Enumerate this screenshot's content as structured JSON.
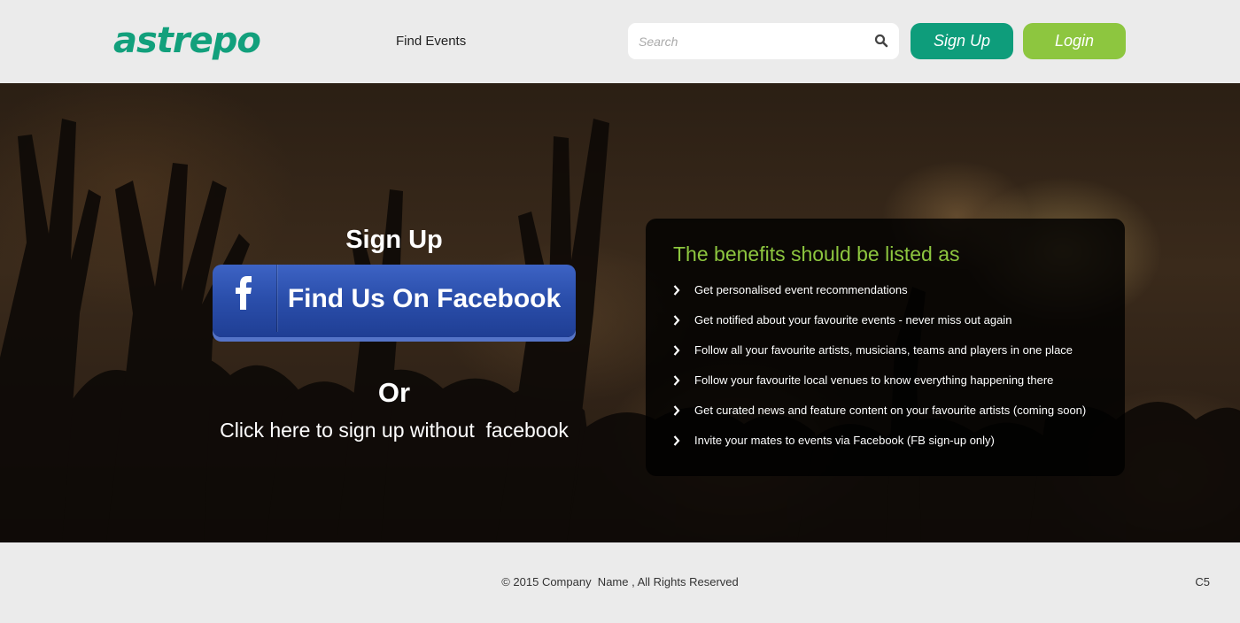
{
  "brand": {
    "logo": "astrepo",
    "logo_color": "#12a07c"
  },
  "nav": {
    "find_events": "Find Events"
  },
  "search": {
    "placeholder": "Search",
    "icon": "search-icon"
  },
  "header_buttons": {
    "signup": "Sign Up",
    "login": "Login"
  },
  "colors": {
    "signup_bg": "#0e9d7b",
    "login_bg": "#8dc63f",
    "benefits_title": "#8dc63f",
    "facebook_blue": "#2b4fac"
  },
  "signup": {
    "title": "Sign Up",
    "facebook_button": "Find Us On Facebook",
    "facebook_icon": "facebook-icon",
    "or_text": "Or",
    "no_facebook_link": "Click here to sign up without  facebook"
  },
  "benefits": {
    "title": "The benefits should be listed as",
    "items": [
      "Get personalised event recommendations",
      "Get notified about your favourite events - never miss out again",
      "Follow all your favourite artists, musicians, teams and players in one place",
      "Follow your favourite local venues to know everything happening there",
      "Get curated news and feature content on your favourite artists (coming soon)",
      "Invite your mates to events via Facebook (FB sign-up only)"
    ]
  },
  "footer": {
    "copyright": "© 2015 Company  Name , All Rights Reserved",
    "version": "C5"
  }
}
